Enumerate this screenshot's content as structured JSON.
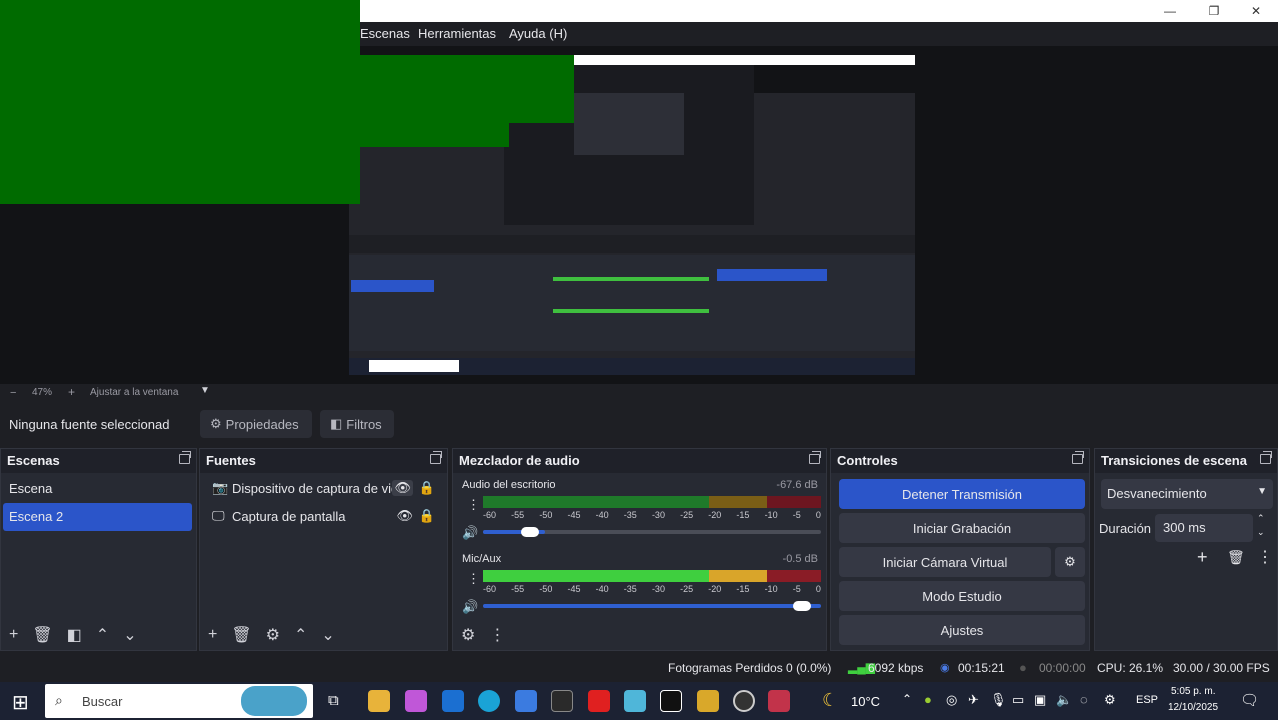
{
  "menu": {
    "items": [
      "Escenas",
      "Herramientas",
      "Ayuda (H)"
    ]
  },
  "zoom": {
    "minus": "−",
    "value": "47%",
    "plus": "+",
    "fit": "Ajustar a la ventana"
  },
  "source_bar": {
    "status": "Ninguna fuente seleccionad",
    "properties": "Propiedades",
    "filters": "Filtros"
  },
  "scenes": {
    "title": "Escenas",
    "items": [
      "Escena",
      "Escena 2"
    ]
  },
  "sources": {
    "title": "Fuentes",
    "items": [
      "Dispositivo de captura de vid",
      "Captura de pantalla"
    ]
  },
  "mixer": {
    "title": "Mezclador de audio",
    "channels": [
      {
        "name": "Audio del escritorio",
        "db": "-67.6 dB"
      },
      {
        "name": "Mic/Aux",
        "db": "-0.5 dB"
      }
    ],
    "ticks": [
      "-60",
      "-55",
      "-50",
      "-45",
      "-40",
      "-35",
      "-30",
      "-25",
      "-20",
      "-15",
      "-10",
      "-5",
      "0"
    ]
  },
  "controls": {
    "title": "Controles",
    "stop_stream": "Detener Transmisión",
    "start_recording": "Iniciar Grabación",
    "start_virtual_cam": "Iniciar Cámara Virtual",
    "studio_mode": "Modo Estudio",
    "settings": "Ajustes"
  },
  "transitions": {
    "title": "Transiciones de escena",
    "selected": "Desvanecimiento",
    "duration_label": "Duración",
    "duration_value": "300 ms"
  },
  "status": {
    "dropped": "Fotogramas Perdidos 0 (0.0%)",
    "kbps": "6092 kbps",
    "stream_time": "00:15:21",
    "rec_time": "00:00:00",
    "cpu": "CPU: 26.1%",
    "fps": "30.00 / 30.00 FPS"
  },
  "taskbar": {
    "search_placeholder": "Buscar",
    "temperature": "10°C",
    "language": "ESP",
    "time": "5:05 p. m.",
    "date": "12/10/2025"
  },
  "colors": {
    "accent": "#2b55c9",
    "green_block": "#006b00",
    "meter_green": "#3fbf3f",
    "meter_yellow": "#c9a22a",
    "meter_red": "#8a1c26"
  },
  "chart_data": {
    "type": "table",
    "levels": [
      {
        "channel": "Audio del escritorio",
        "level_db": -67.6,
        "volume_fraction": 0.2
      },
      {
        "channel": "Mic/Aux",
        "level_db": -0.5,
        "volume_fraction": 1.0
      }
    ]
  }
}
